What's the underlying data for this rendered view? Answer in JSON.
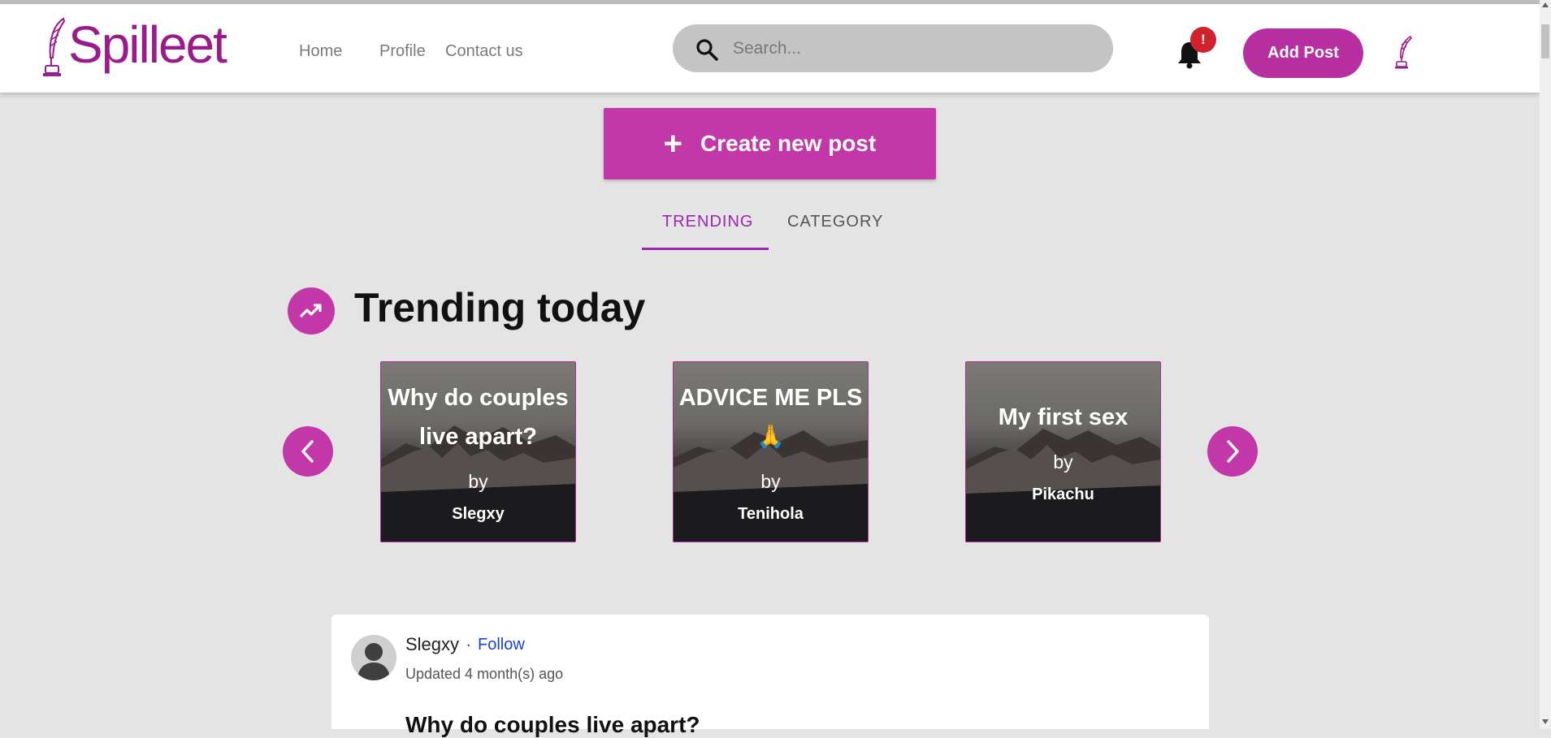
{
  "app": {
    "name": "Spilleet"
  },
  "nav": {
    "home": "Home",
    "profile": "Profile",
    "contact": "Contact us"
  },
  "search": {
    "placeholder": "Search..."
  },
  "notifications": {
    "badge": "!"
  },
  "header": {
    "add_post_label": "Add Post"
  },
  "create_post": {
    "label": "Create new post",
    "icon": "plus-icon"
  },
  "tabs": [
    {
      "label": "TRENDING",
      "active": true
    },
    {
      "label": "CATEGORY",
      "active": false
    }
  ],
  "trending": {
    "title": "Trending today",
    "icon": "trending-up-icon",
    "cards": [
      {
        "title": "Why do couples live apart?",
        "by": "by",
        "author": "Slegxy"
      },
      {
        "title": "ADVICE ME PLS",
        "emoji": "🙏",
        "by": "by",
        "author": "Tenihola"
      },
      {
        "title": "My first sex",
        "by": "by",
        "author": "Pikachu"
      }
    ]
  },
  "post": {
    "author": "Slegxy",
    "separator": "·",
    "follow_label": "Follow",
    "updated": "Updated 4 month(s) ago",
    "title": "Why do couples live apart?"
  },
  "colors": {
    "brand": "#c238a8",
    "brand_dark": "#9b1b8c",
    "tab_active": "#9c27b0",
    "badge": "#d0222d",
    "link": "#1b3fd8"
  }
}
